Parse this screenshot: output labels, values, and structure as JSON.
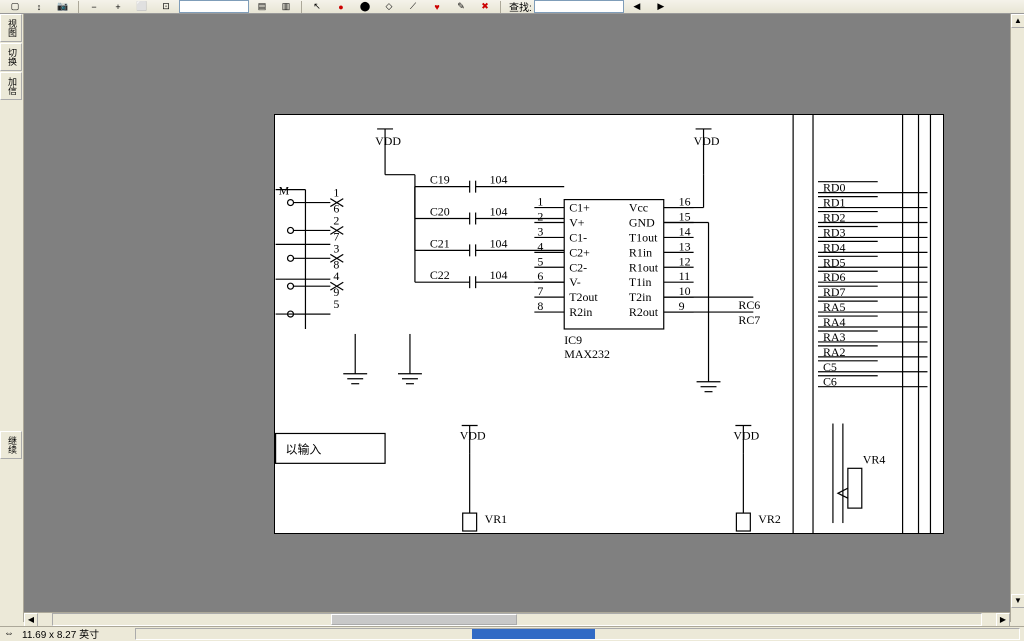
{
  "toolbar": {
    "search_label": "查找:"
  },
  "palette": [
    "视图",
    "切换",
    "加信",
    "继续"
  ],
  "status": {
    "dims": "11.69 x 8.27 英寸"
  },
  "schematic": {
    "power": {
      "vdd": "VDD"
    },
    "caps": [
      {
        "ref": "C19",
        "val": "104"
      },
      {
        "ref": "C20",
        "val": "104"
      },
      {
        "ref": "C21",
        "val": "104"
      },
      {
        "ref": "C22",
        "val": "104"
      }
    ],
    "connector_pins_top": [
      "1",
      "2",
      "3",
      "4",
      "5"
    ],
    "connector_pins_bot": [
      "6",
      "7",
      "8",
      "9"
    ],
    "connector_label": "M",
    "ic": {
      "ref": "IC9",
      "part": "MAX232",
      "left_pins": [
        {
          "n": "1",
          "name": "C1+"
        },
        {
          "n": "2",
          "name": "V+"
        },
        {
          "n": "3",
          "name": "C1-"
        },
        {
          "n": "4",
          "name": "C2+"
        },
        {
          "n": "5",
          "name": "C2-"
        },
        {
          "n": "6",
          "name": "V-"
        },
        {
          "n": "7",
          "name": "T2out"
        },
        {
          "n": "8",
          "name": "R2in"
        }
      ],
      "right_pins": [
        {
          "n": "16",
          "name": "Vcc"
        },
        {
          "n": "15",
          "name": "GND"
        },
        {
          "n": "14",
          "name": "T1out"
        },
        {
          "n": "13",
          "name": "R1in"
        },
        {
          "n": "12",
          "name": "R1out"
        },
        {
          "n": "11",
          "name": "T1in"
        },
        {
          "n": "10",
          "name": "T2in"
        },
        {
          "n": "9",
          "name": "R2out"
        }
      ]
    },
    "nets_right": [
      "RC6",
      "RC7"
    ],
    "bus_labels": [
      "RD0",
      "RD1",
      "RD2",
      "RD3",
      "RD4",
      "RD5",
      "RD6",
      "RD7",
      "RA5",
      "RA4",
      "RA3",
      "RA2",
      "C5",
      "C6"
    ],
    "vr": [
      "VR1",
      "VR2",
      "VR4"
    ],
    "input_box": "以输入"
  }
}
